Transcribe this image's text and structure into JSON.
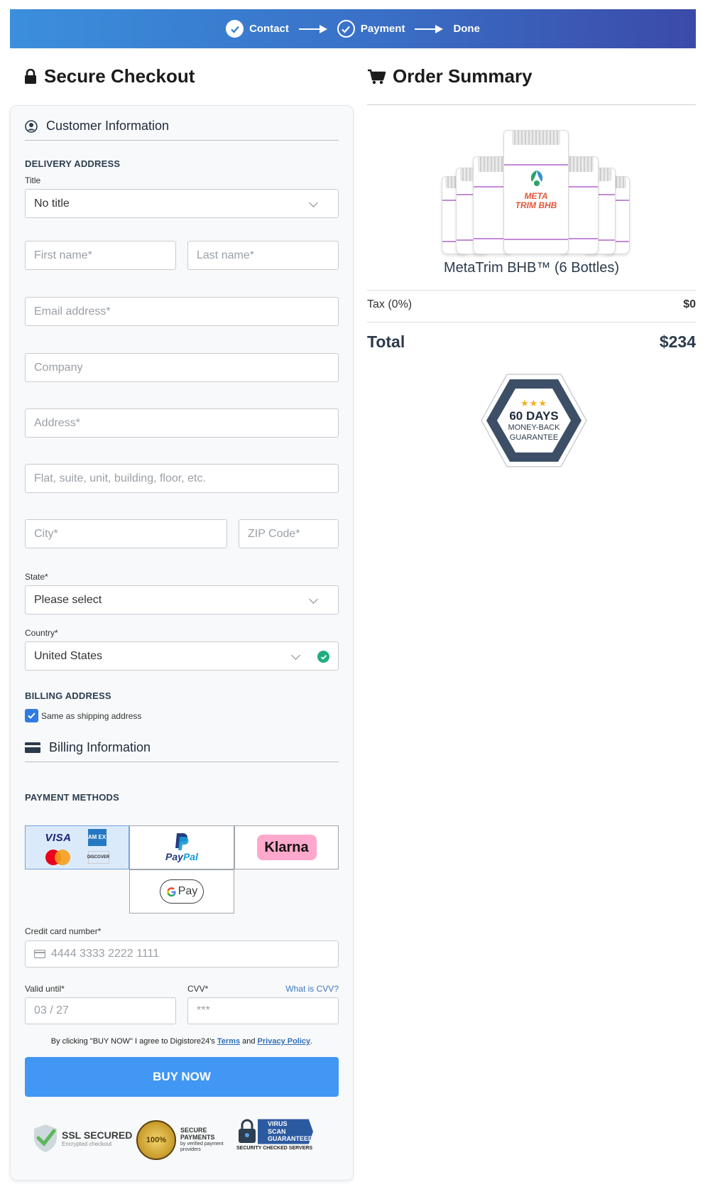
{
  "progress": {
    "steps": [
      {
        "label": "Contact"
      },
      {
        "label": "Payment"
      },
      {
        "label": "Done"
      }
    ]
  },
  "checkout": {
    "title": "Secure Checkout",
    "customer_section": "Customer Information",
    "delivery_label": "DELIVERY ADDRESS",
    "title_label": "Title",
    "title_value": "No title",
    "first_name_placeholder": "First name*",
    "last_name_placeholder": "Last name*",
    "email_placeholder": "Email address*",
    "company_placeholder": "Company",
    "address_placeholder": "Address*",
    "flat_placeholder": "Flat, suite, unit, building, floor, etc.",
    "city_placeholder": "City*",
    "zip_placeholder": "ZIP Code*",
    "state_label": "State*",
    "state_value": "Please select",
    "country_label": "Country*",
    "country_value": "United States",
    "billing_address_label": "BILLING ADDRESS",
    "same_as_shipping": "Same as shipping address",
    "billing_section": "Billing Information",
    "payment_methods_label": "PAYMENT METHODS",
    "payment_logos": {
      "visa": "VISA",
      "amex": "AM EX",
      "discover": "DISCOVER",
      "paypal_a": "Pay",
      "paypal_b": "Pal",
      "klarna": "Klarna",
      "gpay": "Pay"
    },
    "cc_label": "Credit card number*",
    "cc_placeholder": "4444 3333 2222 1111",
    "valid_label": "Valid until*",
    "valid_placeholder": "03 / 27",
    "cvv_label": "CVV*",
    "cvv_link": "What is CVV?",
    "cvv_placeholder": "***",
    "terms_prefix": "By clicking \"BUY NOW\" I agree to Digistore24's",
    "terms_link": "Terms",
    "terms_and": "and",
    "privacy_link": "Privacy Policy",
    "terms_suffix": ".",
    "buy_button": "BUY NOW",
    "trust": {
      "ssl_main": "SSL SECURED",
      "ssl_sub": "Encrypted checkout",
      "seal_text": "100%",
      "secure_payments": "SECURE PAYMENTS",
      "secure_sub": "by verified payment providers",
      "virus_scan": "VIRUS SCAN GUARANTEED",
      "security_checked": "SECURITY CHECKED SERVERS"
    }
  },
  "summary": {
    "title": "Order Summary",
    "product_name": "MetaTrim BHB™ (6 Bottles)",
    "bottle_label": "META TRIM BHB",
    "tax_label": "Tax (0%)",
    "tax_value": "$0",
    "total_label": "Total",
    "total_value": "$234",
    "guarantee": {
      "stars": "★★★",
      "days": "60 DAYS",
      "line1": "MONEY-BACK",
      "line2": "GUARANTEE"
    }
  },
  "colors": {
    "accent": "#4197f3",
    "progress_start": "#3b8fdc",
    "progress_end": "#3b4aa8",
    "check_green": "#1fae7b"
  }
}
